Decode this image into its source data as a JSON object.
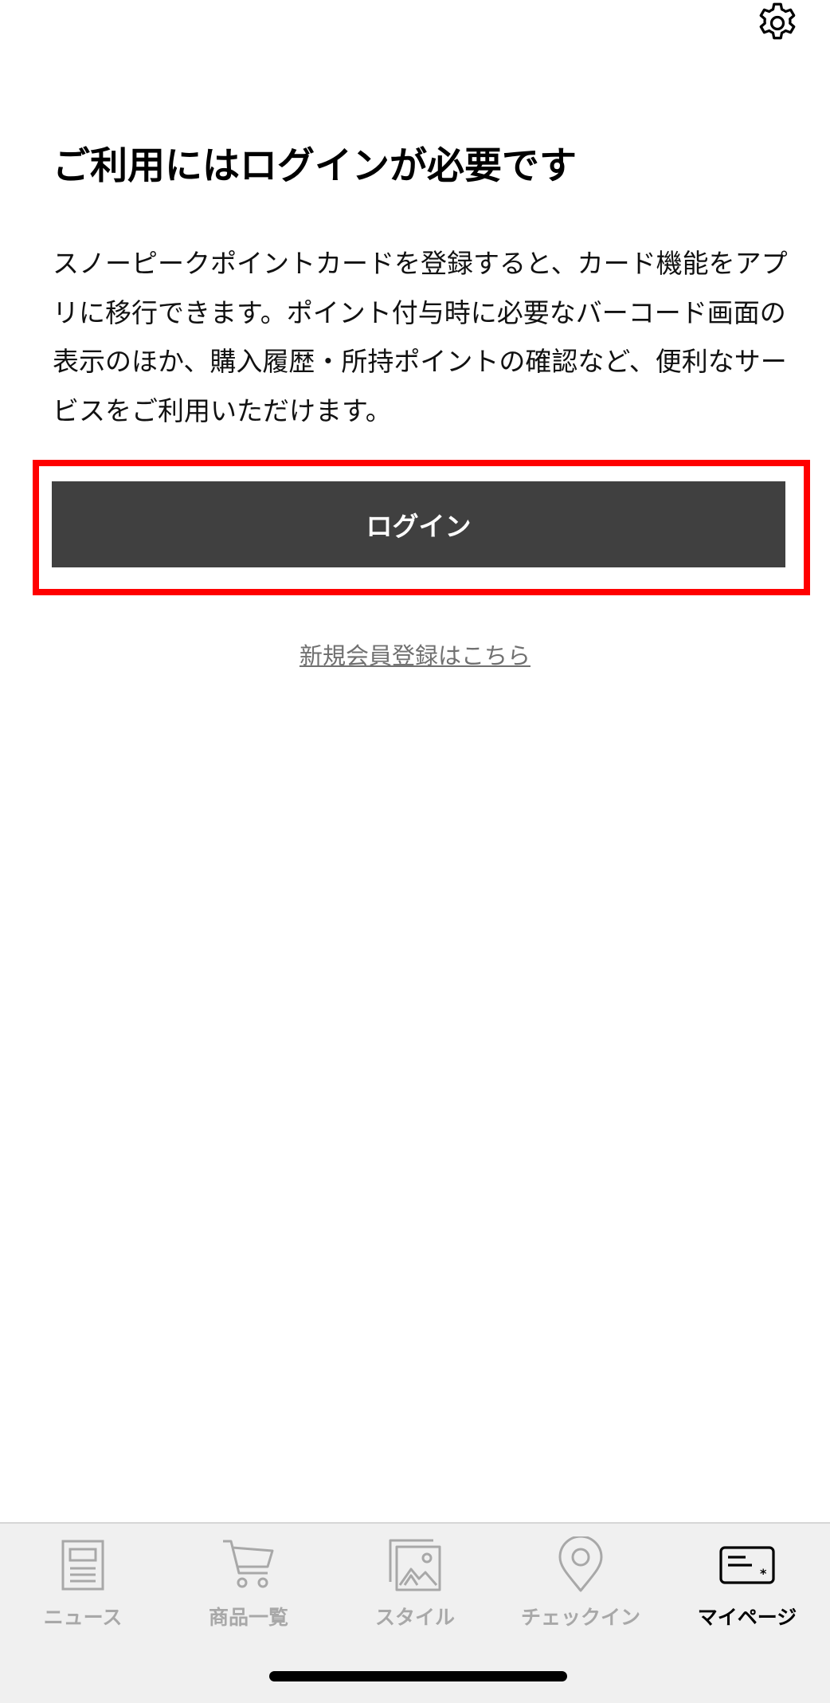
{
  "header": {
    "settings_icon": "gear-icon"
  },
  "main": {
    "title": "ご利用にはログインが必要です",
    "description": "スノーピークポイントカードを登録すると、カード機能をアプリに移行できます。ポイント付与時に必要なバーコード画面の表示のほか、購入履歴・所持ポイントの確認など、便利なサービスをご利用いただけます。",
    "login_label": "ログイン",
    "register_label": "新規会員登録はこちら"
  },
  "tabbar": {
    "items": [
      {
        "label": "ニュース",
        "icon": "newspaper-icon",
        "active": false
      },
      {
        "label": "商品一覧",
        "icon": "cart-icon",
        "active": false
      },
      {
        "label": "スタイル",
        "icon": "photo-icon",
        "active": false
      },
      {
        "label": "チェックイン",
        "icon": "location-pin-icon",
        "active": false
      },
      {
        "label": "マイページ",
        "icon": "member-card-icon",
        "active": true
      }
    ]
  },
  "colors": {
    "button_bg": "#404040",
    "highlight": "#ff0000",
    "inactive_tab": "#a8a8a8",
    "active_tab": "#000000"
  }
}
